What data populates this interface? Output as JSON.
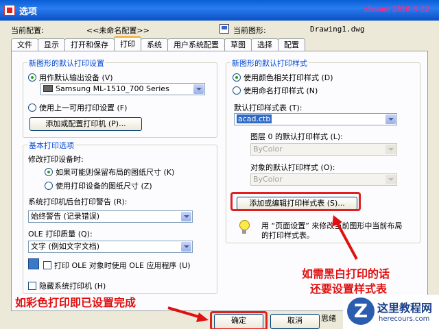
{
  "window": {
    "title": "选项",
    "watermark": "zhsone 2010-3-22"
  },
  "header": {
    "current_config_label": "当前配置:",
    "current_config_value": "<<未命名配置>>",
    "current_drawing_label": "当前图形:",
    "current_drawing_value": "Drawing1.dwg"
  },
  "tabs": [
    {
      "label": "文件"
    },
    {
      "label": "显示"
    },
    {
      "label": "打开和保存"
    },
    {
      "label": "打印"
    },
    {
      "label": "系统"
    },
    {
      "label": "用户系统配置"
    },
    {
      "label": "草图"
    },
    {
      "label": "选择"
    },
    {
      "label": "配置"
    }
  ],
  "left": {
    "group1_title": "新图形的默认打印设置",
    "radio_default_device": "用作默认输出设备 (V)",
    "device_value": "Samsung ML-1510_700 Series",
    "radio_last_settings": "使用上一可用打印设置 (F)",
    "add_printer_button": "添加或配置打印机 (P)...",
    "group2_title": "基本打印选项",
    "change_device_label": "修改打印设备时:",
    "radio_keep_layout": "如果可能则保留布局的图纸尺寸 (K)",
    "radio_use_device": "使用打印设备的图纸尺寸 (Z)",
    "spooler_label": "系统打印机后台打印警告 (R):",
    "spooler_value": "始终警告 (记录错误)",
    "ole_quality_label": "OLE 打印质量 (Q):",
    "ole_quality_value": "文字 (例如文字文档)",
    "ole_app_check": "打印 OLE 对象时使用 OLE 应用程序 (U)",
    "hide_printers_check": "隐藏系统打印机 (H)"
  },
  "right": {
    "group_title": "新图形的默认打印样式",
    "radio_color": "使用颜色相关打印样式 (D)",
    "radio_named": "使用命名打印样式 (N)",
    "default_table_label": "默认打印样式表 (T):",
    "default_table_value": "acad.ctb",
    "layer0_label": "图层 0 的默认打印样式 (L):",
    "layer0_value": "ByColor",
    "object_label": "对象的默认打印样式 (O):",
    "object_value": "ByColor",
    "edit_styles_button": "添加或编辑打印样式表 (S)...",
    "tip_line1": "用 “页面设置” 来修改当前图形中当前布局",
    "tip_line2": "的打印样式表。"
  },
  "footer": {
    "ok_button": "确定",
    "cancel_button": "取消",
    "apply_partial": "思绪"
  },
  "annotations": {
    "note_color": "如彩色打印即已设置完成",
    "note_bw_line1": "如需黑白打印的话",
    "note_bw_line2": "还要设置样式表"
  },
  "logo": {
    "mark": "Z",
    "name": "这里教程网",
    "url": "herecours.com"
  },
  "colors": {
    "titlebar": "#0a5fd6",
    "annotation": "#e01010",
    "selection": "#316ac5"
  }
}
